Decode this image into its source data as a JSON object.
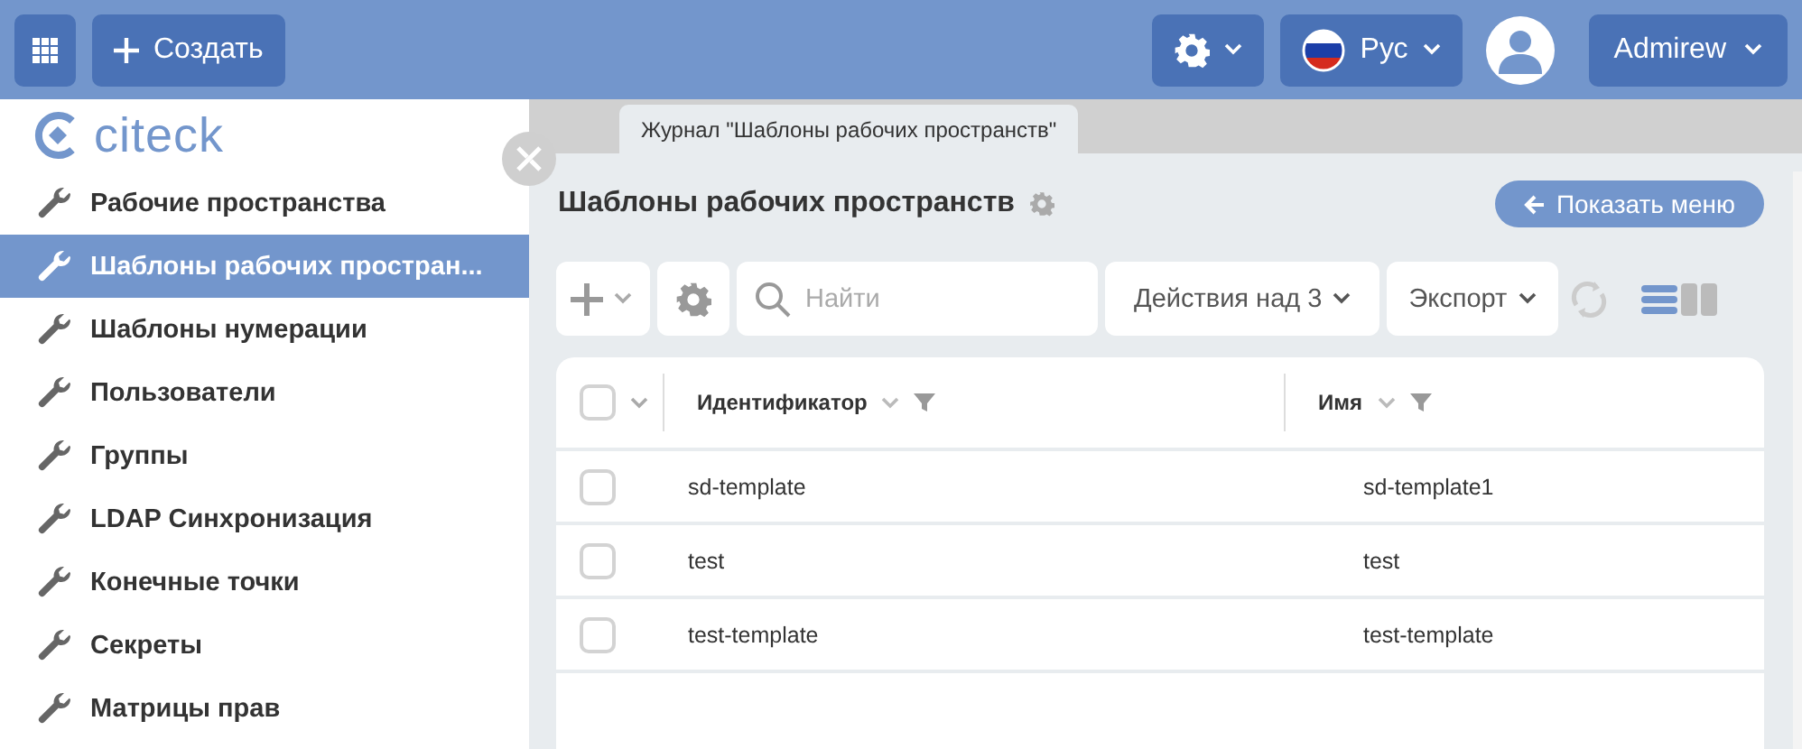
{
  "topbar": {
    "create_label": "Создать",
    "language": "Рус",
    "user": "Admirew"
  },
  "sidebar": {
    "logo": "citeck",
    "items": [
      {
        "label": "Рабочие пространства",
        "selected": false
      },
      {
        "label": "Шаблоны рабочих простран...",
        "selected": true
      },
      {
        "label": "Шаблоны нумерации",
        "selected": false
      },
      {
        "label": "Пользователи",
        "selected": false
      },
      {
        "label": "Группы",
        "selected": false
      },
      {
        "label": "LDAP Синхронизация",
        "selected": false
      },
      {
        "label": "Конечные точки",
        "selected": false
      },
      {
        "label": "Секреты",
        "selected": false
      },
      {
        "label": "Матрицы прав",
        "selected": false
      }
    ]
  },
  "tabs": [
    {
      "label": "Журнал \"Шаблоны рабочих пространств\"",
      "selected": true
    }
  ],
  "page": {
    "title": "Шаблоны рабочих пространств",
    "show_menu": "Показать меню"
  },
  "toolbar": {
    "search": {
      "placeholder": "Найти"
    },
    "actions": "Действия над 3",
    "export": "Экспорт"
  },
  "table": {
    "columns": [
      "Идентификатор",
      "Имя"
    ],
    "header_checked": false,
    "rows": [
      {
        "cells": [
          "sd-template",
          "sd-template1"
        ],
        "selected": false
      },
      {
        "cells": [
          "test",
          "test"
        ],
        "selected": false
      },
      {
        "cells": [
          "test-template",
          "test-template"
        ],
        "selected": false
      }
    ]
  }
}
